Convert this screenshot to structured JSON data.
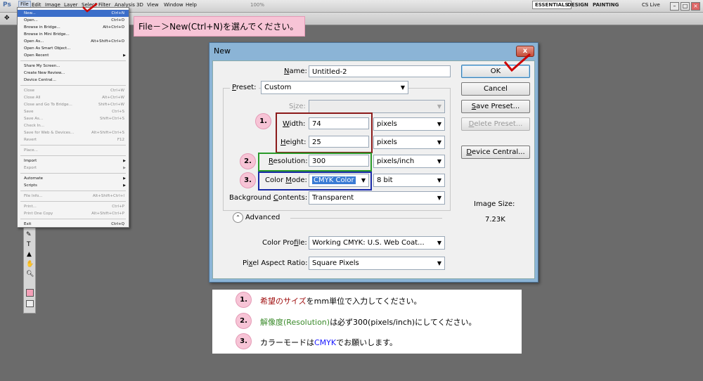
{
  "app": {
    "logo": "Ps",
    "menu": [
      "File",
      "Edit",
      "Image",
      "Layer",
      "Select",
      "Filter",
      "Analysis",
      "3D",
      "View",
      "Window",
      "Help"
    ],
    "zoom": "100%",
    "workspaces": [
      "ESSENTIALS",
      "DESIGN",
      "PAINTING"
    ],
    "cs_live": "CS Live",
    "window_buttons": [
      "–",
      "□",
      "×"
    ]
  },
  "file_menu": [
    {
      "label": "New...",
      "shortcut": "Ctrl+N",
      "state": "highlight"
    },
    {
      "label": "Open...",
      "shortcut": "Ctrl+O"
    },
    {
      "label": "Browse in Bridge...",
      "shortcut": "Alt+Ctrl+O"
    },
    {
      "label": "Browse in Mini Bridge...",
      "shortcut": ""
    },
    {
      "label": "Open As...",
      "shortcut": "Alt+Shift+Ctrl+O"
    },
    {
      "label": "Open As Smart Object...",
      "shortcut": ""
    },
    {
      "label": "Open Recent",
      "shortcut": "",
      "submenu": true
    },
    {
      "sep": true
    },
    {
      "label": "Share My Screen...",
      "shortcut": ""
    },
    {
      "label": "Create New Review...",
      "shortcut": ""
    },
    {
      "label": "Device Central...",
      "shortcut": ""
    },
    {
      "sep": true
    },
    {
      "label": "Close",
      "shortcut": "Ctrl+W",
      "state": "disabled"
    },
    {
      "label": "Close All",
      "shortcut": "Alt+Ctrl+W",
      "state": "disabled"
    },
    {
      "label": "Close and Go To Bridge...",
      "shortcut": "Shift+Ctrl+W",
      "state": "disabled"
    },
    {
      "label": "Save",
      "shortcut": "Ctrl+S",
      "state": "disabled"
    },
    {
      "label": "Save As...",
      "shortcut": "Shift+Ctrl+S",
      "state": "disabled"
    },
    {
      "label": "Check In...",
      "shortcut": "",
      "state": "disabled"
    },
    {
      "label": "Save for Web & Devices...",
      "shortcut": "Alt+Shift+Ctrl+S",
      "state": "disabled"
    },
    {
      "label": "Revert",
      "shortcut": "F12",
      "state": "disabled"
    },
    {
      "sep": true
    },
    {
      "label": "Place...",
      "shortcut": "",
      "state": "disabled"
    },
    {
      "sep": true
    },
    {
      "label": "Import",
      "shortcut": "",
      "submenu": true
    },
    {
      "label": "Export",
      "shortcut": "",
      "submenu": true,
      "state": "disabled"
    },
    {
      "sep": true
    },
    {
      "label": "Automate",
      "shortcut": "",
      "submenu": true
    },
    {
      "label": "Scripts",
      "shortcut": "",
      "submenu": true
    },
    {
      "sep": true
    },
    {
      "label": "File Info...",
      "shortcut": "Alt+Shift+Ctrl+I",
      "state": "disabled"
    },
    {
      "sep": true
    },
    {
      "label": "Print...",
      "shortcut": "Ctrl+P",
      "state": "disabled"
    },
    {
      "label": "Print One Copy",
      "shortcut": "Alt+Shift+Ctrl+P",
      "state": "disabled"
    },
    {
      "sep": true
    },
    {
      "label": "Exit",
      "shortcut": "Ctrl+Q"
    }
  ],
  "callout_top": "File－＞New(Ctrl+N)を選んでください。",
  "dialog": {
    "title": "New",
    "close": "x",
    "name_label": "Name:",
    "name_value": "Untitled-2",
    "preset_label": "Preset:",
    "preset_value": "Custom",
    "size_label": "Size:",
    "size_value": "",
    "width_label": "Width:",
    "width_value": "74",
    "width_unit": "pixels",
    "height_label": "Height:",
    "height_value": "25",
    "height_unit": "pixels",
    "resolution_label": "Resolution:",
    "resolution_value": "300",
    "resolution_unit": "pixels/inch",
    "color_mode_label": "Color Mode:",
    "color_mode_value": "CMYK Color",
    "bit_depth": "8 bit",
    "bg_label": "Background Contents:",
    "bg_value": "Transparent",
    "advanced": "Advanced",
    "color_profile_label": "Color Profile:",
    "color_profile_value": "Working CMYK:  U.S. Web Coat...",
    "par_label": "Pixel Aspect Ratio:",
    "par_value": "Square Pixels",
    "ok": "OK",
    "cancel": "Cancel",
    "save_preset": "Save Preset...",
    "delete_preset": "Delete Preset...",
    "device_central": "Device Central...",
    "image_size_label": "Image Size:",
    "image_size_value": "7.23K",
    "step1": "1.",
    "step2": "2.",
    "step3": "3."
  },
  "note": {
    "n1": "1.",
    "n2": "2.",
    "n3": "3.",
    "r1_a": "希望のサイズ",
    "r1_b": "をmm単位で入力してください。",
    "r2_a": "解像度(Resolution)",
    "r2_b": "は必ず300(pixels/inch)にしてください。",
    "r3_a": "カラーモードは",
    "r3_b": "CMYK",
    "r3_c": "でお願いします。"
  },
  "colors": {
    "accent_red": "#a01010",
    "accent_green": "#3a8a2a",
    "accent_blue": "#1a1aff",
    "callout_pink": "#f7c4d6"
  }
}
